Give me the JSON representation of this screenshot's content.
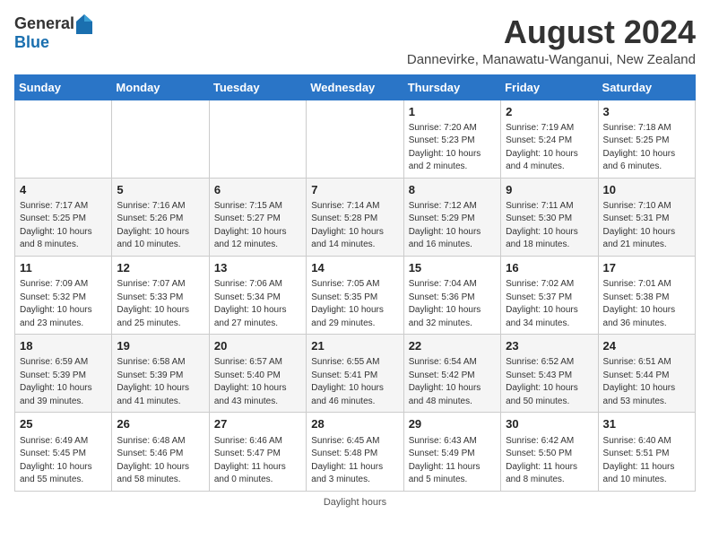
{
  "header": {
    "logo_general": "General",
    "logo_blue": "Blue",
    "month_year": "August 2024",
    "location": "Dannevirke, Manawatu-Wanganui, New Zealand"
  },
  "days_of_week": [
    "Sunday",
    "Monday",
    "Tuesday",
    "Wednesday",
    "Thursday",
    "Friday",
    "Saturday"
  ],
  "weeks": [
    [
      {
        "day": "",
        "info": ""
      },
      {
        "day": "",
        "info": ""
      },
      {
        "day": "",
        "info": ""
      },
      {
        "day": "",
        "info": ""
      },
      {
        "day": "1",
        "info": "Sunrise: 7:20 AM\nSunset: 5:23 PM\nDaylight: 10 hours\nand 2 minutes."
      },
      {
        "day": "2",
        "info": "Sunrise: 7:19 AM\nSunset: 5:24 PM\nDaylight: 10 hours\nand 4 minutes."
      },
      {
        "day": "3",
        "info": "Sunrise: 7:18 AM\nSunset: 5:25 PM\nDaylight: 10 hours\nand 6 minutes."
      }
    ],
    [
      {
        "day": "4",
        "info": "Sunrise: 7:17 AM\nSunset: 5:25 PM\nDaylight: 10 hours\nand 8 minutes."
      },
      {
        "day": "5",
        "info": "Sunrise: 7:16 AM\nSunset: 5:26 PM\nDaylight: 10 hours\nand 10 minutes."
      },
      {
        "day": "6",
        "info": "Sunrise: 7:15 AM\nSunset: 5:27 PM\nDaylight: 10 hours\nand 12 minutes."
      },
      {
        "day": "7",
        "info": "Sunrise: 7:14 AM\nSunset: 5:28 PM\nDaylight: 10 hours\nand 14 minutes."
      },
      {
        "day": "8",
        "info": "Sunrise: 7:12 AM\nSunset: 5:29 PM\nDaylight: 10 hours\nand 16 minutes."
      },
      {
        "day": "9",
        "info": "Sunrise: 7:11 AM\nSunset: 5:30 PM\nDaylight: 10 hours\nand 18 minutes."
      },
      {
        "day": "10",
        "info": "Sunrise: 7:10 AM\nSunset: 5:31 PM\nDaylight: 10 hours\nand 21 minutes."
      }
    ],
    [
      {
        "day": "11",
        "info": "Sunrise: 7:09 AM\nSunset: 5:32 PM\nDaylight: 10 hours\nand 23 minutes."
      },
      {
        "day": "12",
        "info": "Sunrise: 7:07 AM\nSunset: 5:33 PM\nDaylight: 10 hours\nand 25 minutes."
      },
      {
        "day": "13",
        "info": "Sunrise: 7:06 AM\nSunset: 5:34 PM\nDaylight: 10 hours\nand 27 minutes."
      },
      {
        "day": "14",
        "info": "Sunrise: 7:05 AM\nSunset: 5:35 PM\nDaylight: 10 hours\nand 29 minutes."
      },
      {
        "day": "15",
        "info": "Sunrise: 7:04 AM\nSunset: 5:36 PM\nDaylight: 10 hours\nand 32 minutes."
      },
      {
        "day": "16",
        "info": "Sunrise: 7:02 AM\nSunset: 5:37 PM\nDaylight: 10 hours\nand 34 minutes."
      },
      {
        "day": "17",
        "info": "Sunrise: 7:01 AM\nSunset: 5:38 PM\nDaylight: 10 hours\nand 36 minutes."
      }
    ],
    [
      {
        "day": "18",
        "info": "Sunrise: 6:59 AM\nSunset: 5:39 PM\nDaylight: 10 hours\nand 39 minutes."
      },
      {
        "day": "19",
        "info": "Sunrise: 6:58 AM\nSunset: 5:39 PM\nDaylight: 10 hours\nand 41 minutes."
      },
      {
        "day": "20",
        "info": "Sunrise: 6:57 AM\nSunset: 5:40 PM\nDaylight: 10 hours\nand 43 minutes."
      },
      {
        "day": "21",
        "info": "Sunrise: 6:55 AM\nSunset: 5:41 PM\nDaylight: 10 hours\nand 46 minutes."
      },
      {
        "day": "22",
        "info": "Sunrise: 6:54 AM\nSunset: 5:42 PM\nDaylight: 10 hours\nand 48 minutes."
      },
      {
        "day": "23",
        "info": "Sunrise: 6:52 AM\nSunset: 5:43 PM\nDaylight: 10 hours\nand 50 minutes."
      },
      {
        "day": "24",
        "info": "Sunrise: 6:51 AM\nSunset: 5:44 PM\nDaylight: 10 hours\nand 53 minutes."
      }
    ],
    [
      {
        "day": "25",
        "info": "Sunrise: 6:49 AM\nSunset: 5:45 PM\nDaylight: 10 hours\nand 55 minutes."
      },
      {
        "day": "26",
        "info": "Sunrise: 6:48 AM\nSunset: 5:46 PM\nDaylight: 10 hours\nand 58 minutes."
      },
      {
        "day": "27",
        "info": "Sunrise: 6:46 AM\nSunset: 5:47 PM\nDaylight: 11 hours\nand 0 minutes."
      },
      {
        "day": "28",
        "info": "Sunrise: 6:45 AM\nSunset: 5:48 PM\nDaylight: 11 hours\nand 3 minutes."
      },
      {
        "day": "29",
        "info": "Sunrise: 6:43 AM\nSunset: 5:49 PM\nDaylight: 11 hours\nand 5 minutes."
      },
      {
        "day": "30",
        "info": "Sunrise: 6:42 AM\nSunset: 5:50 PM\nDaylight: 11 hours\nand 8 minutes."
      },
      {
        "day": "31",
        "info": "Sunrise: 6:40 AM\nSunset: 5:51 PM\nDaylight: 11 hours\nand 10 minutes."
      }
    ]
  ],
  "footer": {
    "daylight_label": "Daylight hours"
  }
}
